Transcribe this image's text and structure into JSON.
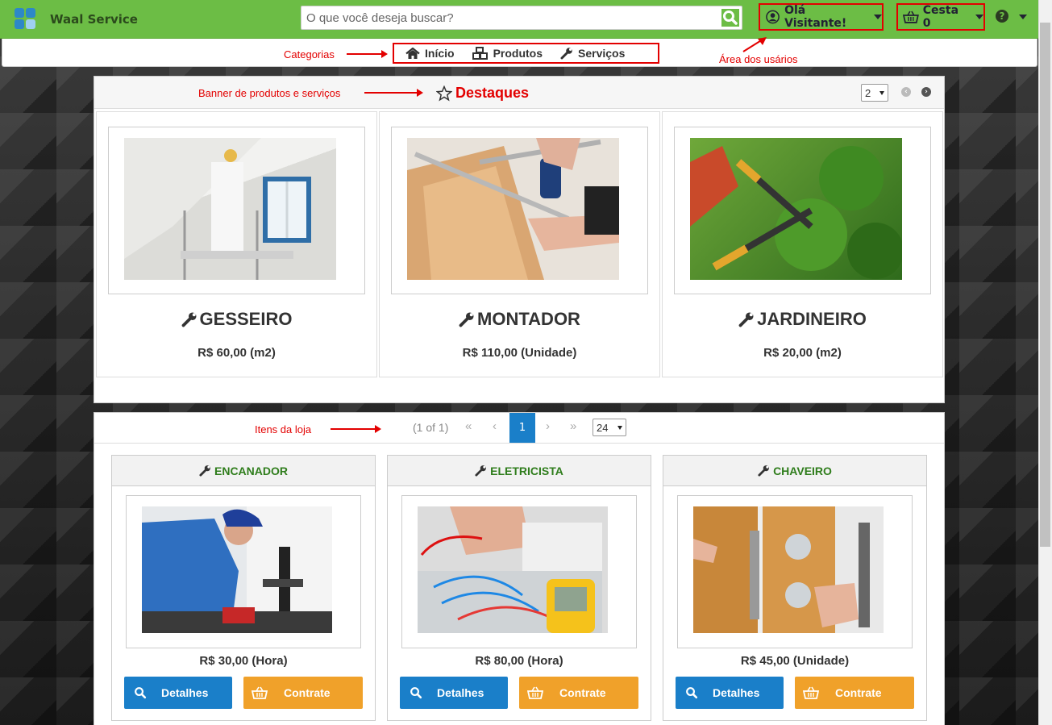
{
  "app": {
    "brand": "Waal Service"
  },
  "search": {
    "placeholder": "O que você deseja buscar?",
    "icon": "search-icon"
  },
  "user_menu": {
    "label": "Olá Visitante!"
  },
  "cart": {
    "label": "Cesta 0"
  },
  "nav": {
    "items": [
      {
        "label": "Início",
        "icon": "home-icon"
      },
      {
        "label": "Produtos",
        "icon": "cubes-icon"
      },
      {
        "label": "Serviços",
        "icon": "wrench-icon"
      }
    ]
  },
  "annotations": {
    "categorias": "Categorias",
    "area_usuarios": "Área dos usários",
    "banner": "Banner de produtos e serviços",
    "itens": "Itens da loja"
  },
  "featured": {
    "title": "Destaques",
    "rows_select": "2",
    "items": [
      {
        "name": "GESSEIRO",
        "price": "R$ 60,00 (m2)"
      },
      {
        "name": "MONTADOR",
        "price": "R$ 110,00 (Unidade)"
      },
      {
        "name": "JARDINEIRO",
        "price": "R$ 20,00 (m2)"
      }
    ]
  },
  "paginator": {
    "report": "(1 of 1)",
    "first": "«",
    "prev": "‹",
    "current": "1",
    "next": "›",
    "last": "»",
    "rows_select": "24"
  },
  "store": {
    "items": [
      {
        "name": "ENCANADOR",
        "price": "R$ 30,00 (Hora)",
        "details": "Detalhes",
        "hire": "Contrate"
      },
      {
        "name": "ELETRICISTA",
        "price": "R$ 80,00 (Hora)",
        "details": "Detalhes",
        "hire": "Contrate"
      },
      {
        "name": "CHAVEIRO",
        "price": "R$ 45,00 (Unidade)",
        "details": "Detalhes",
        "hire": "Contrate"
      }
    ]
  },
  "colors": {
    "header_green": "#6cbd45",
    "annotation_red": "#e30000",
    "primary_blue": "#1a7fc9",
    "accent_orange": "#f0a12a",
    "title_green": "#2f7d1c"
  }
}
